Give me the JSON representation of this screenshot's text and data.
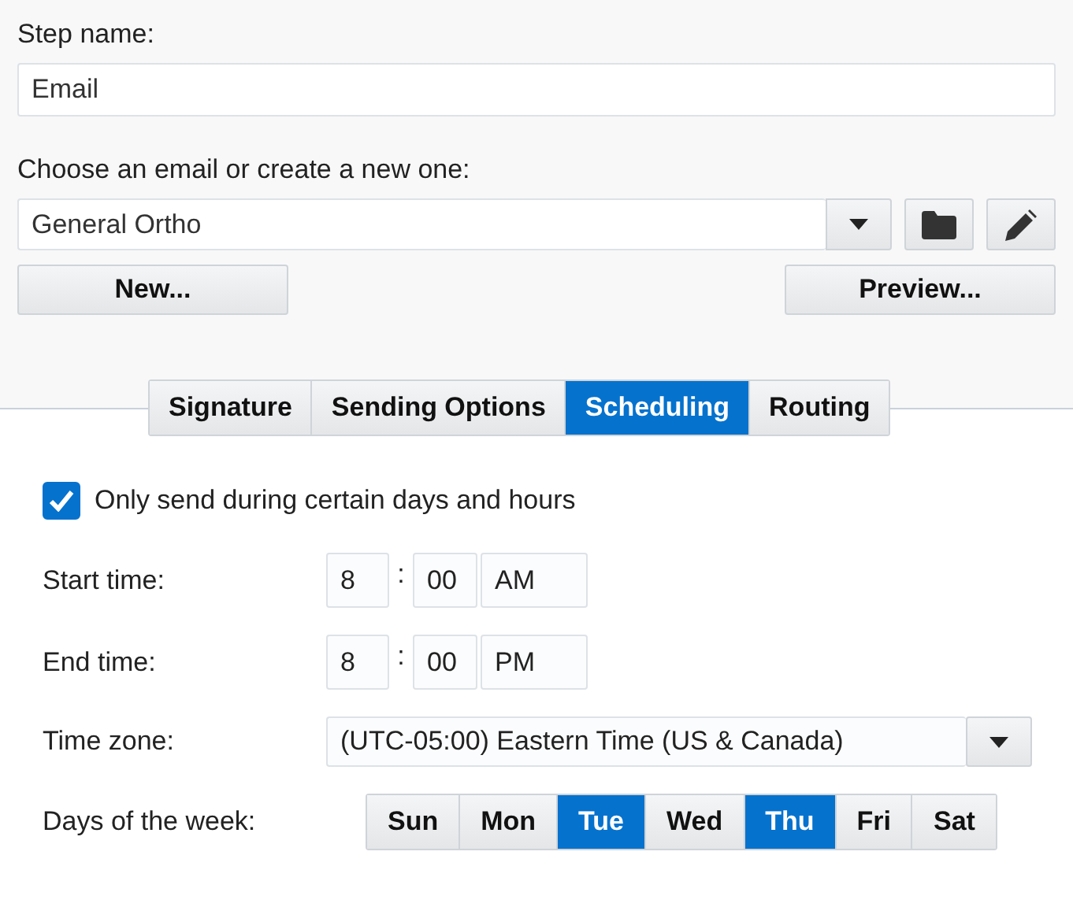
{
  "step_name": {
    "label": "Step name:",
    "value": "Email"
  },
  "email": {
    "label": "Choose an email or create a new one:",
    "value": "General Ortho"
  },
  "buttons": {
    "new": "New...",
    "preview": "Preview..."
  },
  "tabs": [
    {
      "label": "Signature",
      "selected": false
    },
    {
      "label": "Sending Options",
      "selected": false
    },
    {
      "label": "Scheduling",
      "selected": true
    },
    {
      "label": "Routing",
      "selected": false
    }
  ],
  "only_send": {
    "label": "Only send during certain days and hours",
    "checked": true
  },
  "start_time": {
    "label": "Start time:",
    "hour": "8",
    "separator": ":",
    "minute": "00",
    "period": "AM"
  },
  "end_time": {
    "label": "End time:",
    "hour": "8",
    "separator": ":",
    "minute": "00",
    "period": "PM"
  },
  "time_zone": {
    "label": "Time zone:",
    "value": "(UTC-05:00) Eastern Time (US & Canada)"
  },
  "days": {
    "label": "Days of the week:",
    "items": [
      {
        "label": "Sun",
        "selected": false
      },
      {
        "label": "Mon",
        "selected": false
      },
      {
        "label": "Tue",
        "selected": true
      },
      {
        "label": "Wed",
        "selected": false
      },
      {
        "label": "Thu",
        "selected": true
      },
      {
        "label": "Fri",
        "selected": false
      },
      {
        "label": "Sat",
        "selected": false
      }
    ]
  }
}
